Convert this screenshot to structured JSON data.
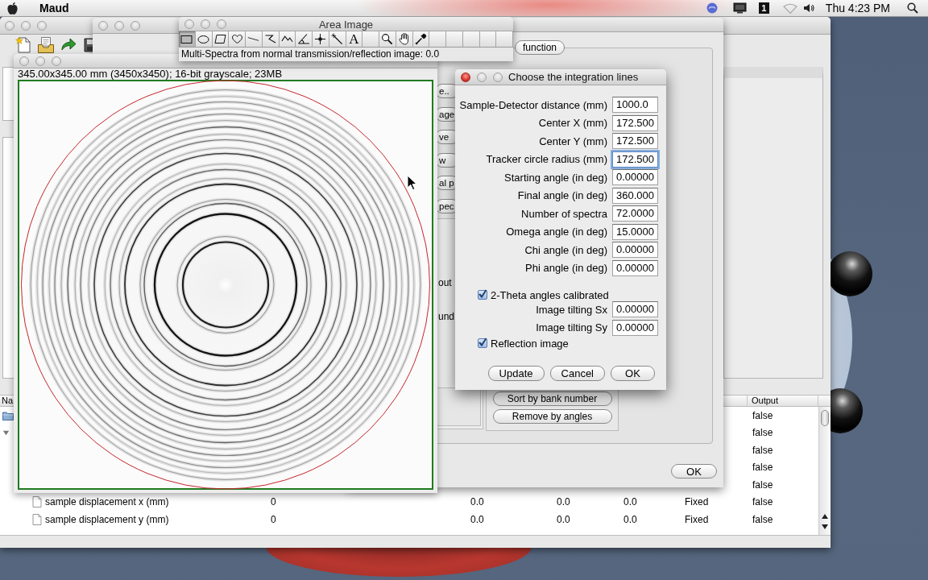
{
  "menu_bar": {
    "app_name": "Maud",
    "spaces_indicator": "1",
    "clock": "Thu 4:23 PM"
  },
  "main_window": {
    "active": false,
    "toolbar": [
      {
        "kind": "new"
      },
      {
        "kind": "open"
      },
      {
        "kind": "forward"
      },
      {
        "kind": "save"
      }
    ],
    "table": {
      "header": {
        "name": "Na",
        "output": "Output"
      },
      "rows": [
        {
          "kind": "folder",
          "output": "false"
        },
        {
          "kind": "group",
          "expanded": true,
          "output": "false",
          "children": [
            {
              "kind": "plain",
              "output": "false"
            },
            {
              "kind": "plain",
              "output": "false"
            },
            {
              "kind": "plain",
              "output": "false"
            },
            {
              "kind": "leaf",
              "name": "sample displacement x (mm)",
              "column_2": "0",
              "column_3": "0.0",
              "column_4": "0.0",
              "column_5": "0.0",
              "column_6": "Fixed",
              "output": "false"
            },
            {
              "kind": "leaf",
              "name": "sample displacement y (mm)",
              "column_2": "0",
              "column_3": "0.0",
              "column_4": "0.0",
              "column_5": "0.0",
              "column_6": "Fixed",
              "output": "false"
            }
          ]
        }
      ]
    }
  },
  "second_window": {
    "active": false
  },
  "options_window": {
    "tabs": [
      {
        "label": "function",
        "selected": false
      }
    ],
    "side_buttons": [
      "e..",
      "age",
      "ve",
      "w",
      "al p",
      "pec"
    ],
    "side_labels": [
      "out",
      "und"
    ],
    "buttons": [
      "Sort by bank number",
      "Remove by angles"
    ],
    "ok_button": "OK"
  },
  "image_window": {
    "active": false,
    "info": "345.00x345.00 mm (3450x3450); 16-bit grayscale; 23MB"
  },
  "area_image": {
    "active": false,
    "title": "Area Image",
    "tools": [
      {
        "kind": "rectangle",
        "selected": true
      },
      {
        "kind": "oval",
        "selected": false
      },
      {
        "kind": "polygon",
        "selected": false
      },
      {
        "kind": "freehand",
        "selected": false
      },
      {
        "kind": "line",
        "selected": false
      },
      {
        "kind": "segmented",
        "selected": false
      },
      {
        "kind": "freeline",
        "selected": false
      },
      {
        "kind": "angle",
        "selected": false
      },
      {
        "kind": "point",
        "selected": false
      },
      {
        "kind": "wand",
        "selected": false
      },
      {
        "kind": "text",
        "label": "A",
        "selected": false
      },
      {
        "kind": "empty",
        "selected": false
      },
      {
        "kind": "zoom",
        "selected": false
      },
      {
        "kind": "hand",
        "selected": false
      },
      {
        "kind": "dropper",
        "selected": false
      },
      {
        "kind": "empty",
        "selected": false
      },
      {
        "kind": "empty",
        "selected": false
      },
      {
        "kind": "empty",
        "selected": false
      },
      {
        "kind": "empty",
        "selected": false
      },
      {
        "kind": "empty",
        "selected": false
      }
    ],
    "status": "Multi-Spectra from normal transmission/reflection image: 0.0"
  },
  "integration_dialog": {
    "active": true,
    "title": "Choose the integration lines",
    "items": [
      {
        "kind": "field",
        "label": "Sample-Detector distance (mm)",
        "value": "1000.0",
        "focused": false
      },
      {
        "kind": "field",
        "label": "Center X (mm)",
        "value": "172.500",
        "focused": false
      },
      {
        "kind": "field",
        "label": "Center Y (mm)",
        "value": "172.500",
        "focused": false
      },
      {
        "kind": "field",
        "label": "Tracker circle radius (mm)",
        "value": "172.500",
        "focused": true
      },
      {
        "kind": "field",
        "label": "Starting angle (in deg)",
        "value": "0.00000",
        "focused": false
      },
      {
        "kind": "field",
        "label": "Final angle (in deg)",
        "value": "360.000",
        "focused": false
      },
      {
        "kind": "field",
        "label": "Number of spectra",
        "value": "72.0000",
        "focused": false
      },
      {
        "kind": "field",
        "label": "Omega angle (in deg)",
        "value": "15.0000",
        "focused": false
      },
      {
        "kind": "field",
        "label": "Chi angle (in deg)",
        "value": "0.00000",
        "focused": false
      },
      {
        "kind": "field",
        "label": "Phi angle (in deg)",
        "value": "0.00000",
        "focused": false
      },
      {
        "kind": "checkbox",
        "label": "2-Theta angles calibrated",
        "checked": true
      },
      {
        "kind": "field",
        "label": "Image tilting Sx",
        "value": "0.00000",
        "focused": false
      },
      {
        "kind": "field",
        "label": "Image tilting Sy",
        "value": "0.00000",
        "focused": false
      },
      {
        "kind": "checkbox",
        "label": "Reflection image",
        "checked": true
      }
    ],
    "buttons": [
      "Update",
      "Cancel",
      "OK"
    ]
  }
}
